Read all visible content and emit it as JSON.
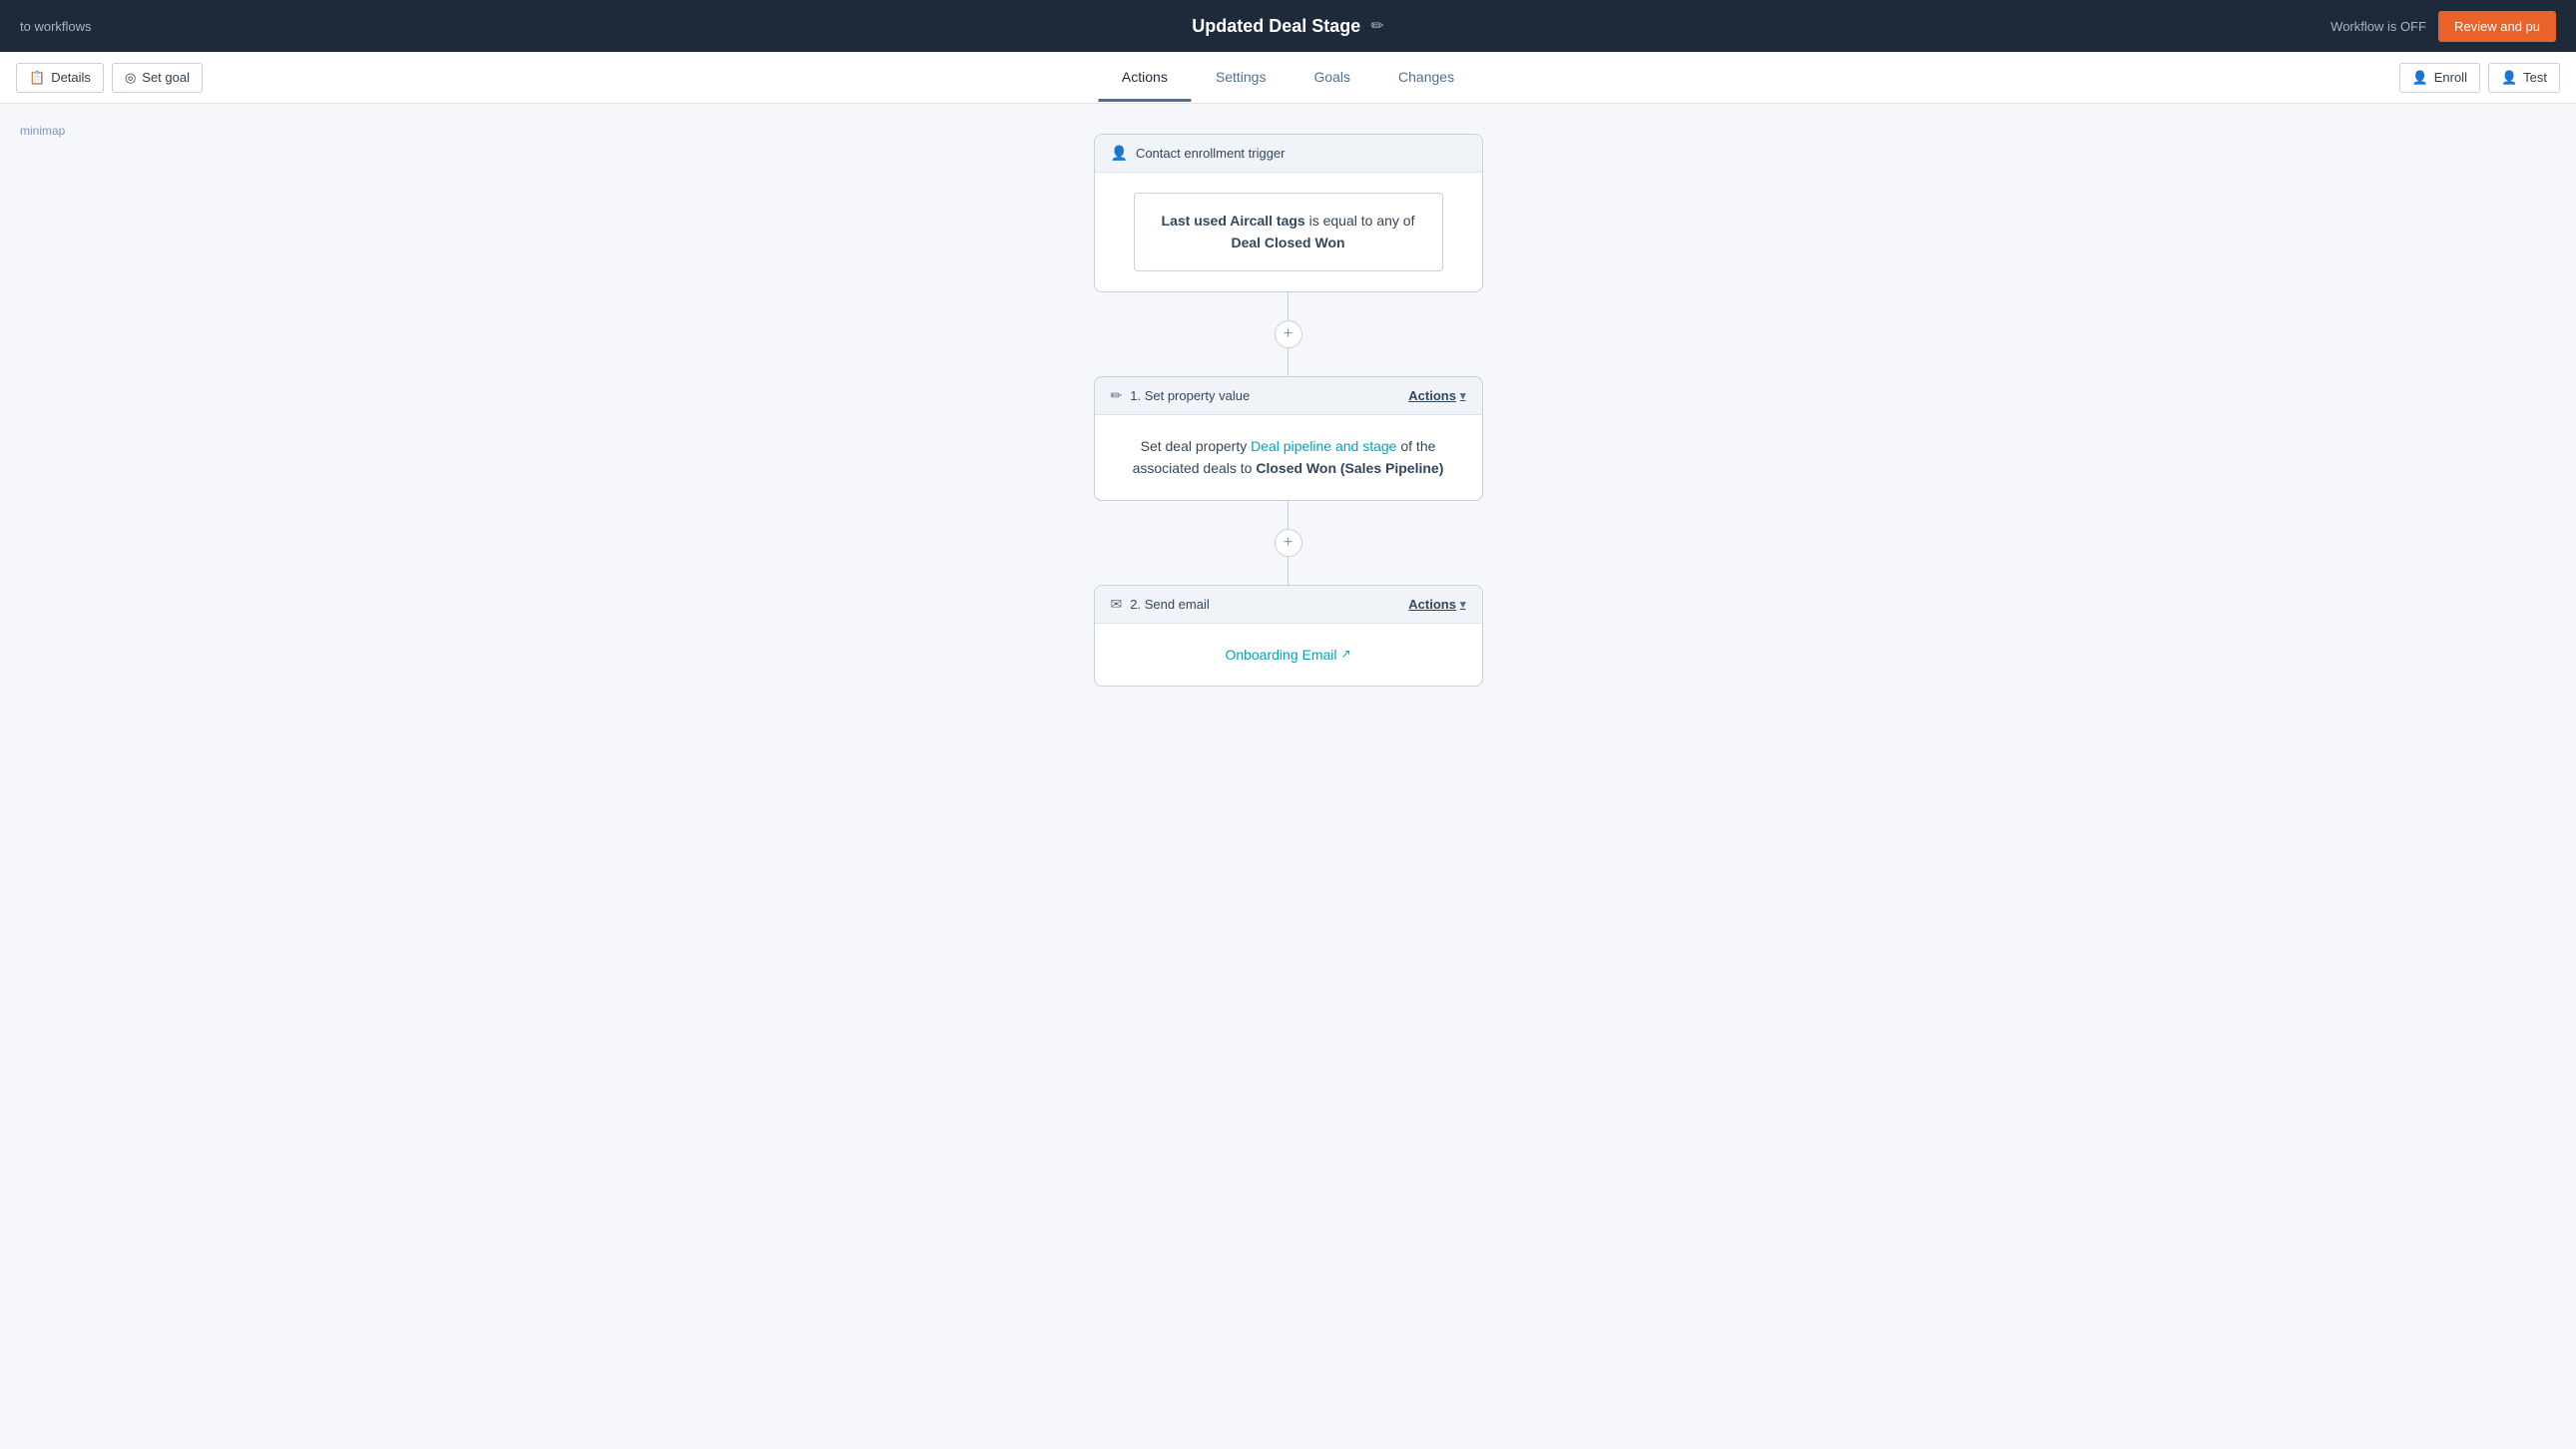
{
  "topBar": {
    "backLabel": "to workflows",
    "title": "Updated Deal Stage",
    "editIconLabel": "✏",
    "statusLabel": "Workflow is OFF",
    "reviewButtonLabel": "Review and pu"
  },
  "navBar": {
    "detailsButtonIcon": "📋",
    "detailsButtonLabel": "Details",
    "setGoalButtonIcon": "◎",
    "setGoalButtonLabel": "Set goal",
    "tabs": [
      {
        "label": "Actions",
        "active": true
      },
      {
        "label": "Settings",
        "active": false
      },
      {
        "label": "Goals",
        "active": false
      },
      {
        "label": "Changes",
        "active": false
      }
    ],
    "enrollButtonIcon": "👤",
    "enrollButtonLabel": "Enroll",
    "testButtonIcon": "👤",
    "testButtonLabel": "Test"
  },
  "canvas": {
    "minimapLabel": "minimap",
    "triggerNode": {
      "headerLabel": "Contact enrollment trigger",
      "condition": {
        "boldText": "Last used Aircall tags",
        "plainText1": " is equal to any of",
        "boldText2": "Deal Closed Won"
      }
    },
    "connector1": {
      "plusLabel": "+"
    },
    "actionNode1": {
      "headerLabel": "1. Set property value",
      "actionsLabel": "Actions",
      "body": {
        "prefixText": "Set deal property ",
        "linkText": "Deal pipeline and stage",
        "suffixText": " of the associated deals to ",
        "boldText": "Closed Won (Sales Pipeline)"
      }
    },
    "connector2": {
      "plusLabel": "+"
    },
    "actionNode2": {
      "headerLabel": "2. Send email",
      "actionsLabel": "Actions",
      "body": {
        "emailLinkText": "Onboarding Email",
        "externalIcon": "↗"
      }
    }
  }
}
